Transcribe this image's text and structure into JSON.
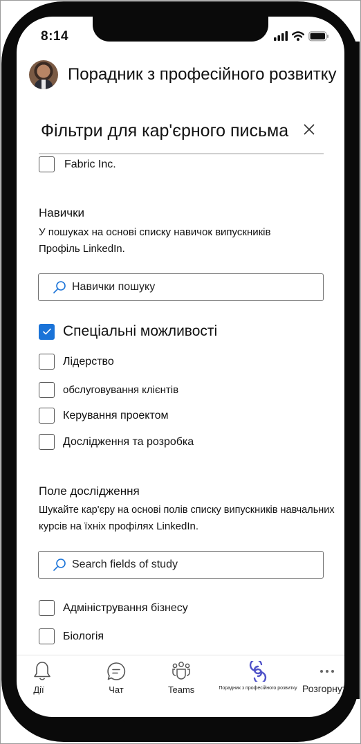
{
  "status_bar": {
    "time": "8:14",
    "icons": [
      "signal-icon",
      "wifi-icon",
      "battery-icon"
    ]
  },
  "header": {
    "title": "Порадник з професійного розвитку",
    "avatar": "user-avatar"
  },
  "panel": {
    "title": "Фільтри для кар'єрного письма",
    "close_icon": "close-icon",
    "company_item": {
      "label": "Fabric Inc.",
      "checked": false
    },
    "skills": {
      "title": "Навички",
      "description_line1": "У пошуках на основі списку навичок випускників",
      "description_line2": "Профіль LinkedIn.",
      "search_placeholder": "Навички пошуку",
      "items": [
        {
          "label": "Спеціальні можливості",
          "checked": true
        },
        {
          "label": "Лідерство",
          "checked": false
        },
        {
          "label": "обслуговування клієнтів",
          "checked": false
        },
        {
          "label": "Керування проектом",
          "checked": false
        },
        {
          "label": "Дослідження та розробка",
          "checked": false
        }
      ]
    },
    "field_of_study": {
      "title": "Поле дослідження",
      "description_line1": "Шукайте кар'єру на основі полів списку випускників навчальних",
      "description_line2": "курсів на їхніх профілях LinkedIn.",
      "search_placeholder": "Search fields of study",
      "items": [
        {
          "label": "Адміністрування бізнесу",
          "checked": false
        },
        {
          "label": "Біологія",
          "checked": false
        }
      ]
    }
  },
  "tab_bar": {
    "tabs": [
      {
        "label": "Дії",
        "icon": "bell-icon",
        "active": false
      },
      {
        "label": "Чат",
        "icon": "chat-icon",
        "active": false
      },
      {
        "label": "Teams",
        "icon": "teams-icon",
        "active": false
      },
      {
        "label": "Порадник з професійного розвитку",
        "icon": "career-coach-icon",
        "active": true
      },
      {
        "label": "Розгорнути",
        "icon": "more-icon",
        "active": false
      }
    ],
    "active_color": "#4f52c8"
  },
  "colors": {
    "checkbox_checked": "#1a73d8",
    "search_icon": "#1a73d8"
  }
}
